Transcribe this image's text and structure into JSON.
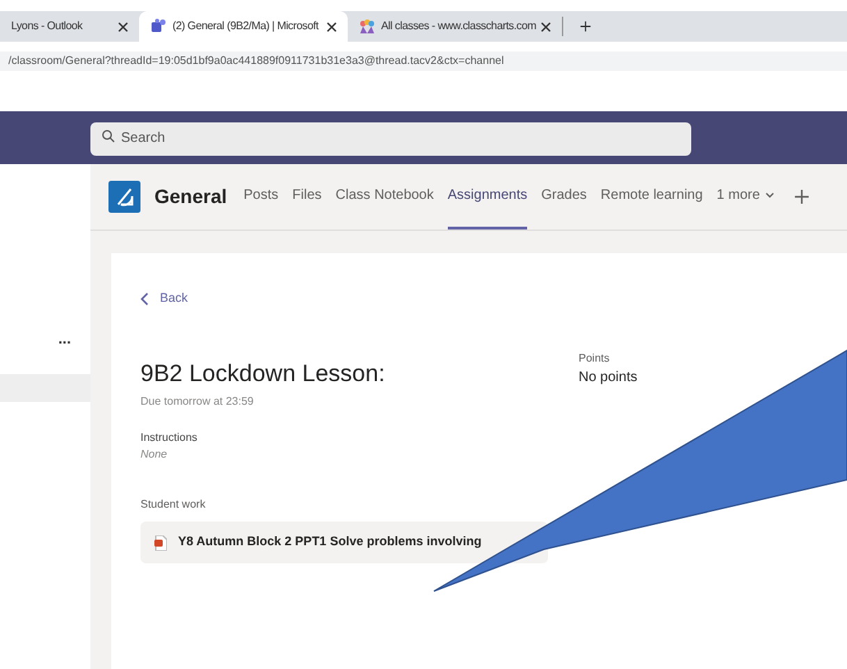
{
  "browser_tabs": [
    {
      "title": "Lyons - Outlook",
      "selected": false
    },
    {
      "title": "(2) General (9B2/Ma) | Microsoft",
      "selected": true
    },
    {
      "title": "All classes - www.classcharts.com",
      "selected": false
    }
  ],
  "address": "/classroom/General?threadId=19:05d1bf9a0ac441889f0911731b31e3a3@thread.tacv2&ctx=channel",
  "search": {
    "placeholder": "Search"
  },
  "sidebar": {
    "more": "..."
  },
  "channel": {
    "name": "General",
    "tabs": [
      {
        "label": "Posts",
        "selected": false
      },
      {
        "label": "Files",
        "selected": false
      },
      {
        "label": "Class Notebook",
        "selected": false
      },
      {
        "label": "Assignments",
        "selected": true
      },
      {
        "label": "Grades",
        "selected": false
      },
      {
        "label": "Remote learning",
        "selected": false
      },
      {
        "label": "1 more",
        "selected": false
      }
    ]
  },
  "assignment": {
    "back": "Back",
    "title": "9B2 Lockdown Lesson:",
    "due": "Due tomorrow at 23:59",
    "points_label": "Points",
    "points": "No points",
    "instructions_label": "Instructions",
    "instructions": "None",
    "student_work_label": "Student work",
    "file": "Y8 Autumn Block 2 PPT1 Solve problems involving"
  }
}
